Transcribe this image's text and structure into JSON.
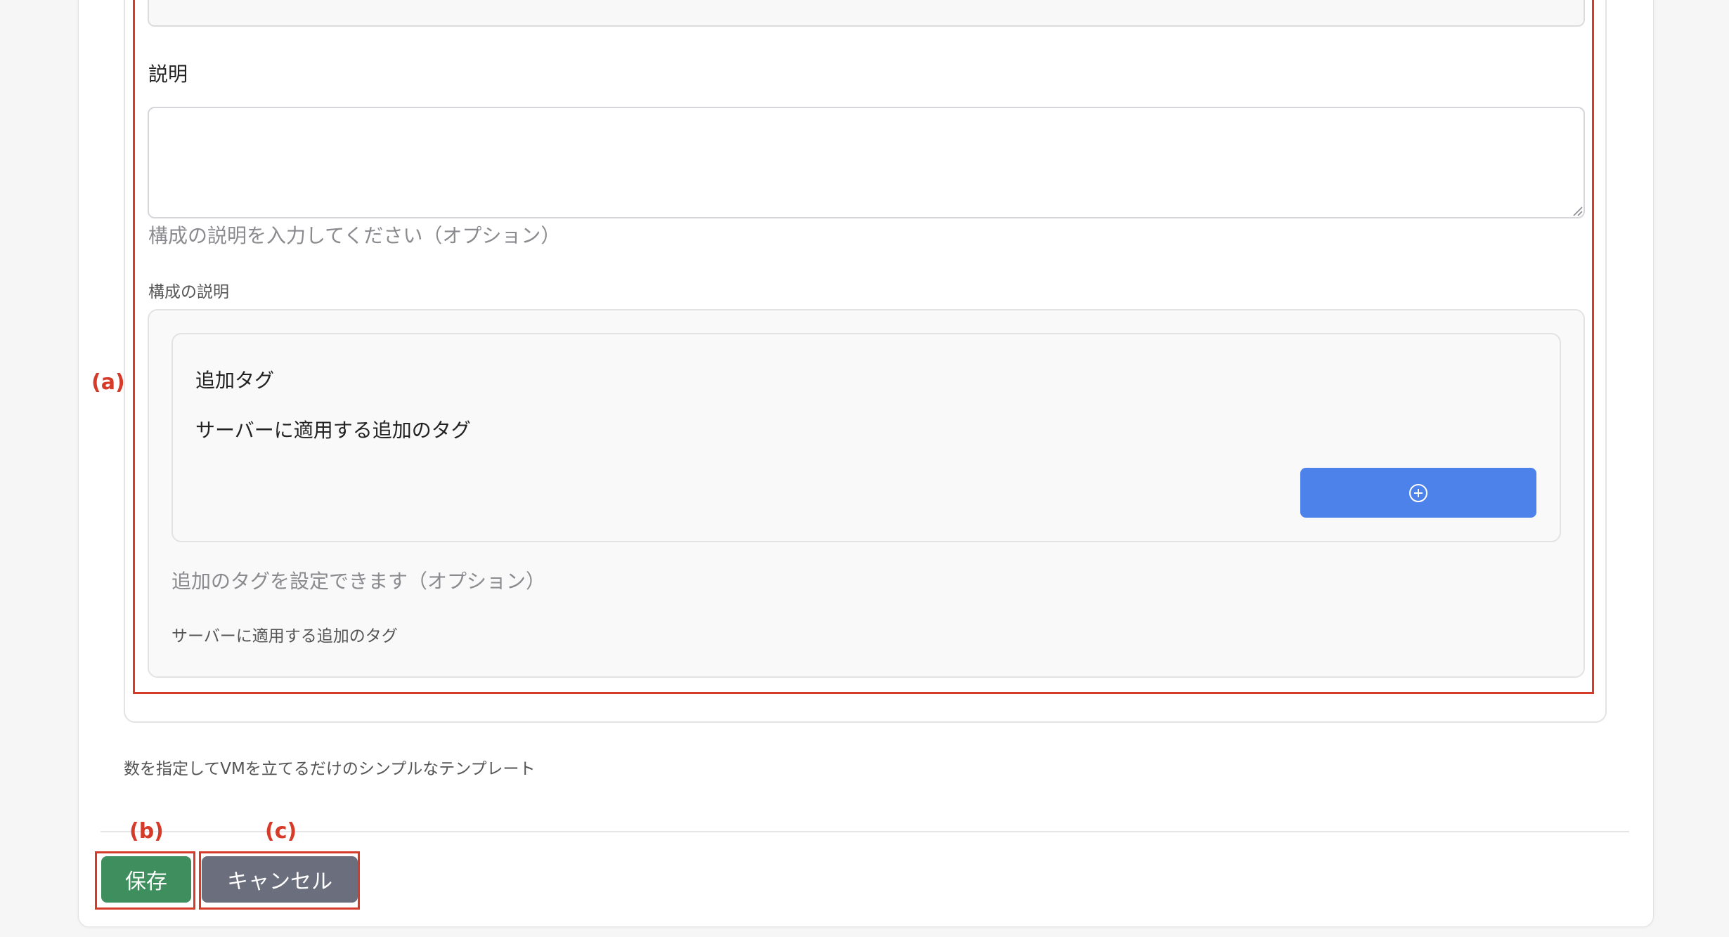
{
  "form": {
    "description_label": "説明",
    "description_value": "",
    "description_help": "構成の説明を入力してください（オプション）",
    "config_description_label": "構成の説明"
  },
  "tags_section": {
    "title": "追加タグ",
    "subtitle": "サーバーに適用する追加のタグ",
    "add_button_icon": "plus-circle-icon",
    "help": "追加のタグを設定できます（オプション）",
    "sub_label": "サーバーに適用する追加のタグ"
  },
  "template": {
    "description": "数を指定してVMを立てるだけのシンプルなテンプレート"
  },
  "footer": {
    "save_label": "保存",
    "cancel_label": "キャンセル"
  },
  "annotations": {
    "a": "(a)",
    "b": "(b)",
    "c": "(c)"
  },
  "colors": {
    "accent_blue": "#4d82ea",
    "save_green": "#3f8f5e",
    "cancel_gray": "#6b6e7d",
    "annotation_red": "#d63b2a"
  }
}
